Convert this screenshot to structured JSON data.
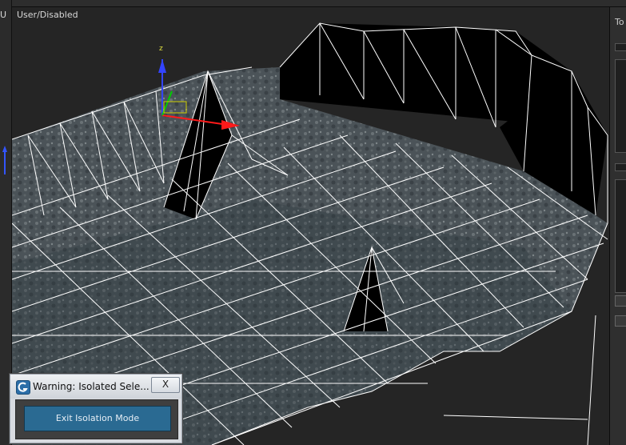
{
  "viewport": {
    "label": "User/Disabled",
    "side_label": "U",
    "gizmo_axis_label": "z"
  },
  "right_panel": {
    "tab_label": "To"
  },
  "dialog": {
    "title": "Warning: Isolated Sele...",
    "close_label": "X",
    "exit_button_label": "Exit Isolation Mode"
  },
  "colors": {
    "wire": "#ffffff",
    "viewport_bg": "#252525",
    "gizmo_x": "#ff0000",
    "gizmo_y": "#00cc00",
    "gizmo_z": "#0000ff",
    "exit_button": "#2a6a92"
  }
}
